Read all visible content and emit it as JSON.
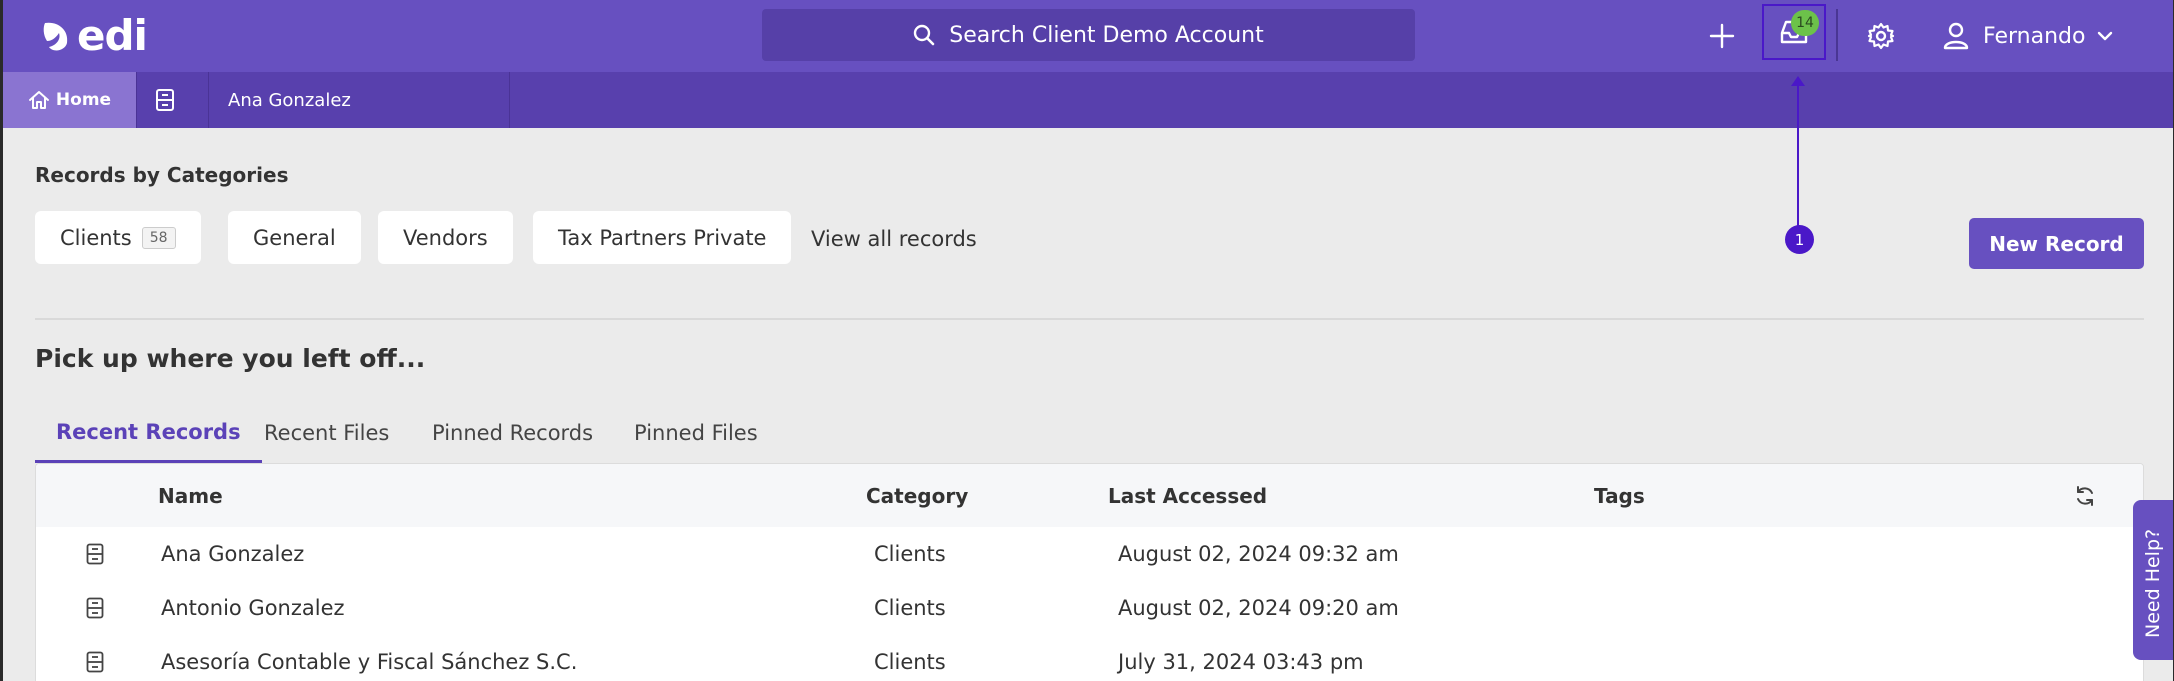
{
  "app": {
    "logo_text": "edi"
  },
  "search": {
    "placeholder": "Search Client Demo Account"
  },
  "top_nav": {
    "inbox_badge": "14",
    "user_name": "Fernando"
  },
  "breadcrumb": {
    "home_label": "Home",
    "record_label": "Ana Gonzalez"
  },
  "records_by_categories": {
    "title": "Records by Categories",
    "chips": [
      {
        "label": "Clients",
        "count": "58"
      },
      {
        "label": "General"
      },
      {
        "label": "Vendors"
      },
      {
        "label": "Tax Partners Private"
      }
    ],
    "view_all": "View all records",
    "new_record_label": "New Record"
  },
  "annotation": {
    "label": "1"
  },
  "pickup": {
    "title": "Pick up where you left off...",
    "tabs": [
      "Recent Records",
      "Recent Files",
      "Pinned Records",
      "Pinned Files"
    ],
    "active_tab": "Recent Records"
  },
  "table": {
    "headers": {
      "name": "Name",
      "category": "Category",
      "last_accessed": "Last Accessed",
      "tags": "Tags"
    },
    "rows": [
      {
        "name": "Ana Gonzalez",
        "category": "Clients",
        "last_accessed": "August 02, 2024 09:32 am",
        "tags": ""
      },
      {
        "name": "Antonio Gonzalez",
        "category": "Clients",
        "last_accessed": "August 02, 2024 09:20 am",
        "tags": ""
      },
      {
        "name": "Asesoría Contable y Fiscal Sánchez S.C.",
        "category": "Clients",
        "last_accessed": "July 31, 2024 03:43 pm",
        "tags": ""
      }
    ]
  },
  "help": {
    "label": "Need Help?"
  },
  "colors": {
    "brand": "#6750c0",
    "brand_dark": "#5840ad",
    "badge_green": "#6cc24a",
    "annotation": "#4a18c8"
  },
  "icons": [
    "leaf-logo-icon",
    "search-icon",
    "plus-icon",
    "inbox-icon",
    "gear-icon",
    "user-icon",
    "chevron-down-icon",
    "home-icon",
    "record-icon",
    "refresh-icon"
  ]
}
